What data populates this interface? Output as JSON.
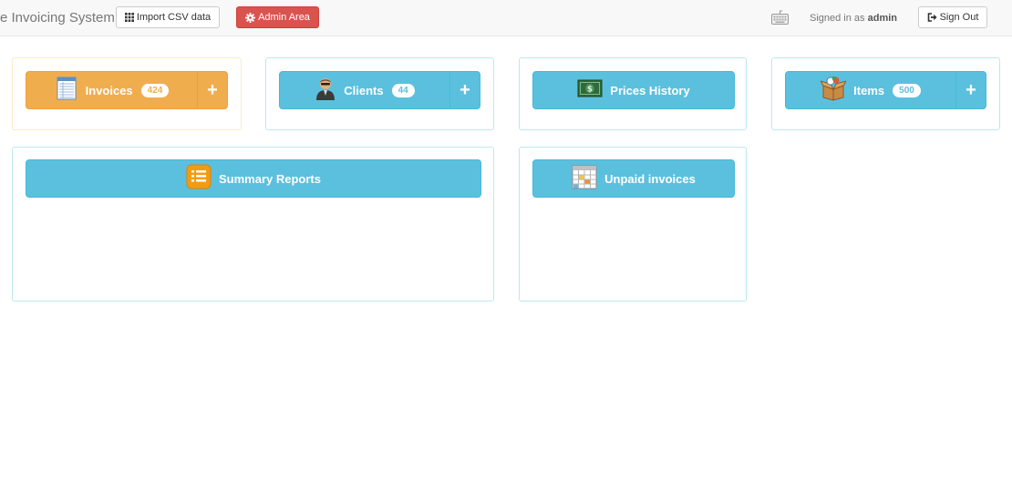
{
  "navbar": {
    "brand": "e Invoicing System",
    "import_label": "Import CSV data",
    "admin_label": "Admin Area",
    "signed_in_prefix": "Signed in as",
    "username": "admin",
    "signout_label": "Sign Out"
  },
  "tiles": {
    "invoices": {
      "label": "Invoices",
      "count": "424",
      "icon": "invoice-document-icon"
    },
    "clients": {
      "label": "Clients",
      "count": "44",
      "icon": "person-icon"
    },
    "prices_history": {
      "label": "Prices History",
      "icon": "money-bill-icon"
    },
    "items": {
      "label": "Items",
      "count": "500",
      "icon": "box-icon"
    },
    "summary_reports": {
      "label": "Summary Reports",
      "icon": "report-list-icon"
    },
    "unpaid_invoices": {
      "label": "Unpaid invoices",
      "icon": "calendar-icon"
    }
  },
  "colors": {
    "info": "#5bc0de",
    "warning": "#f0ad4e",
    "danger": "#d9534f"
  }
}
